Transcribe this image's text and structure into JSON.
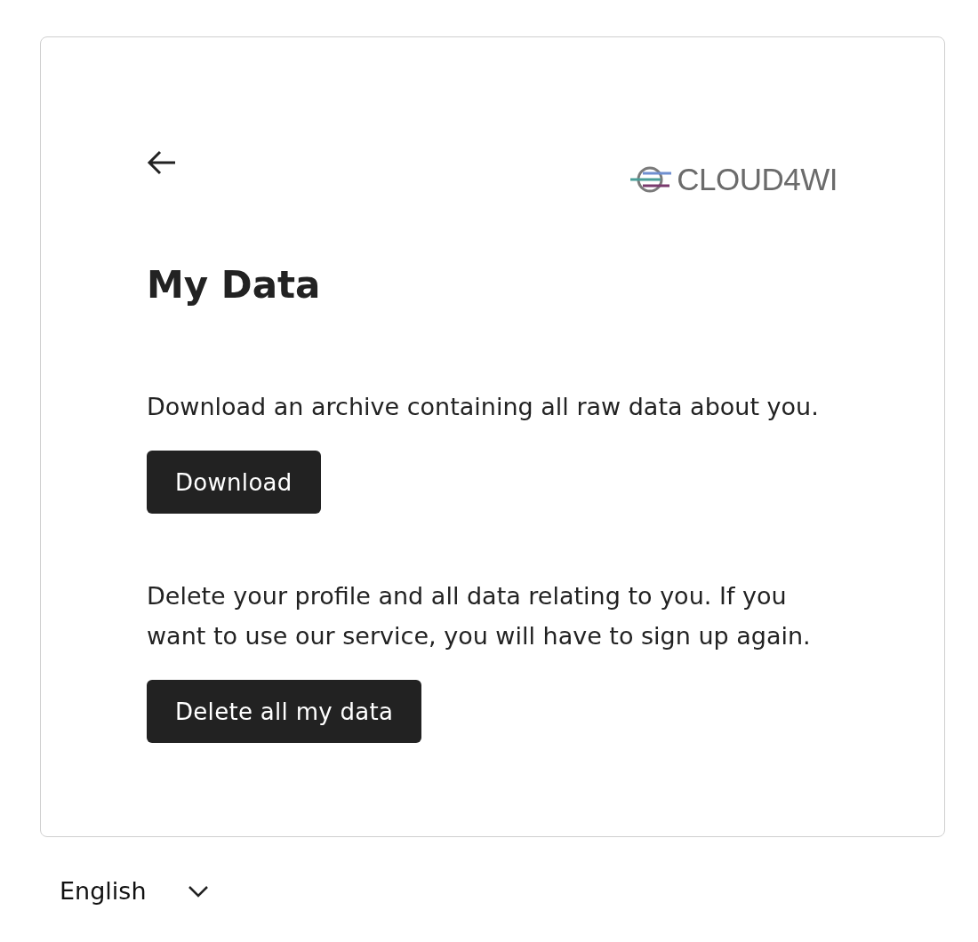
{
  "logo": {
    "text": "CLOUD4WI"
  },
  "title": "My Data",
  "sections": [
    {
      "description": "Download an archive containing all raw data about you.",
      "button": "Download"
    },
    {
      "description": "Delete your profile and all data relating to you. If you want to use our service, you will have to sign up again.",
      "button": "Delete all my data"
    }
  ],
  "language_select": {
    "value": "English"
  }
}
